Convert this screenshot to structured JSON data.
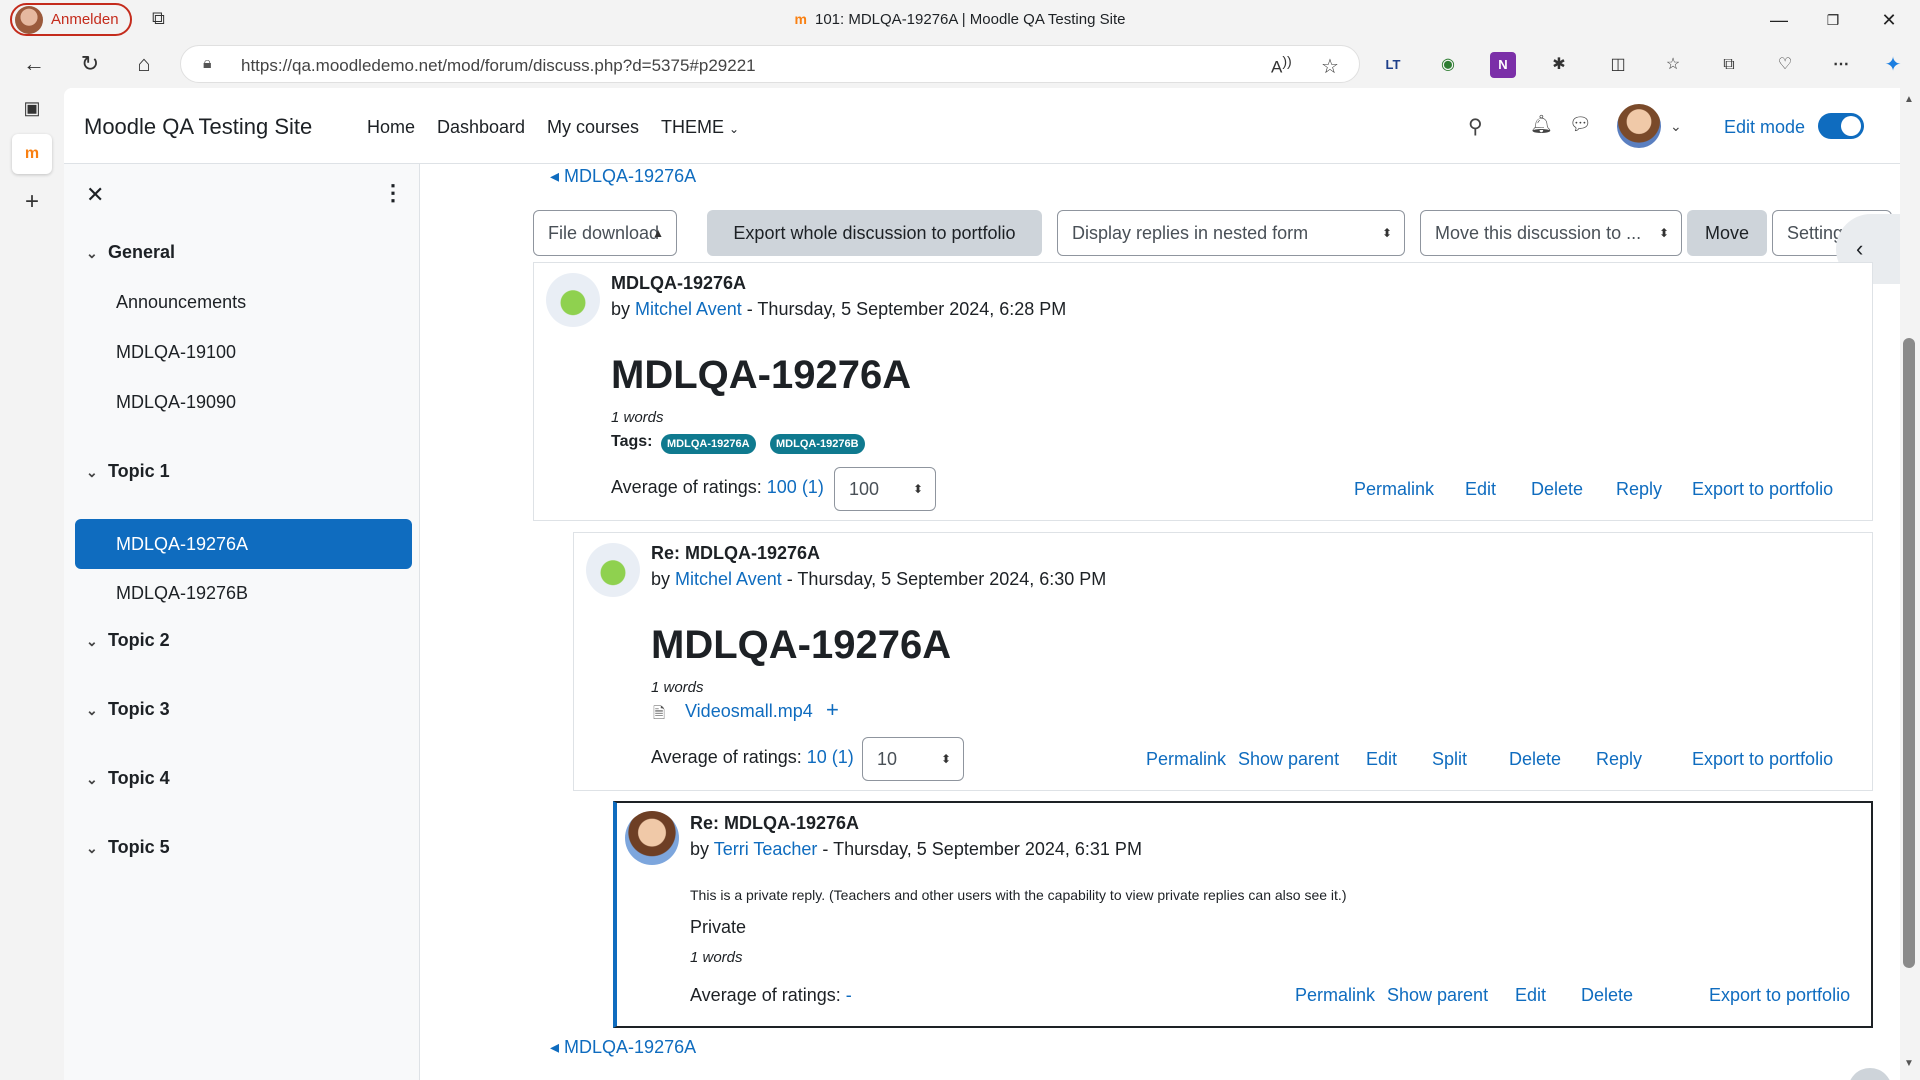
{
  "browser": {
    "profile_label": "Anmelden",
    "window_title": "101: MDLQA-19276A | Moodle QA Testing Site",
    "favicon_text": "m",
    "url": "https://qa.moodledemo.net/mod/forum/discuss.php?d=5375#p29221",
    "read_aloud_icon": "Â̲"
  },
  "header": {
    "site_name": "Moodle QA Testing Site",
    "nav": [
      "Home",
      "Dashboard",
      "My courses",
      "THEME"
    ],
    "edit_mode_label": "Edit mode"
  },
  "drawer": {
    "sections": [
      {
        "title": "General",
        "items": [
          "Announcements",
          "MDLQA-19100",
          "MDLQA-19090"
        ]
      },
      {
        "title": "Topic 1",
        "items": [
          "MDLQA-19276A",
          "MDLQA-19276B"
        ]
      },
      {
        "title": "Topic 2",
        "items": []
      },
      {
        "title": "Topic 3",
        "items": []
      },
      {
        "title": "Topic 4",
        "items": []
      },
      {
        "title": "Topic 5",
        "items": []
      }
    ],
    "active_item": "MDLQA-19276A"
  },
  "toolbar": {
    "back_link": "◂ MDLQA-19276A",
    "file_download": "File download",
    "export_whole": "Export whole discussion to portfolio",
    "display_mode": "Display replies in nested form",
    "move_to": "Move this discussion to ...",
    "move_button": "Move",
    "settings_button": "Settings"
  },
  "posts": [
    {
      "subject": "MDLQA-19276A",
      "by": "by",
      "author": "Mitchel Avent",
      "date": " - Thursday, 5 September 2024, 6:28 PM",
      "heading": "MDLQA-19276A",
      "words": "1 words",
      "tags_label": "Tags:",
      "tags": [
        "MDLQA-19276A",
        "MDLQA-19276B"
      ],
      "ratings_label": "Average of ratings:",
      "ratings_value": "100 (1)",
      "rating_select": "100",
      "commands": [
        "Permalink",
        "Edit",
        "Delete",
        "Reply",
        "Export to portfolio"
      ]
    },
    {
      "subject": "Re: MDLQA-19276A",
      "by": "by",
      "author": "Mitchel Avent",
      "date": " - Thursday, 5 September 2024, 6:30 PM",
      "heading": "MDLQA-19276A",
      "words": "1 words",
      "attachment": "Videosmall.mp4",
      "ratings_label": "Average of ratings:",
      "ratings_value": "10 (1)",
      "rating_select": "10",
      "commands": [
        "Permalink",
        "Show parent",
        "Edit",
        "Split",
        "Delete",
        "Reply",
        "Export to portfolio"
      ]
    },
    {
      "subject": "Re: MDLQA-19276A",
      "by": "by",
      "author": "Terri Teacher",
      "date": " - Thursday, 5 September 2024, 6:31 PM",
      "private_note": "This is a private reply. (Teachers and other users with the capability to view private replies can also see it.)",
      "body": "Private",
      "words": "1 words",
      "ratings_label": "Average of ratings:",
      "ratings_value": "-",
      "commands": [
        "Permalink",
        "Show parent",
        "Edit",
        "Delete",
        "Export to portfolio"
      ]
    }
  ],
  "footer_back_link": "◂ MDLQA-19276A",
  "help_label": "?",
  "colors": {
    "accent": "#0f6cbf",
    "tag": "#0f7a8f",
    "profile": "#c42b1c"
  }
}
